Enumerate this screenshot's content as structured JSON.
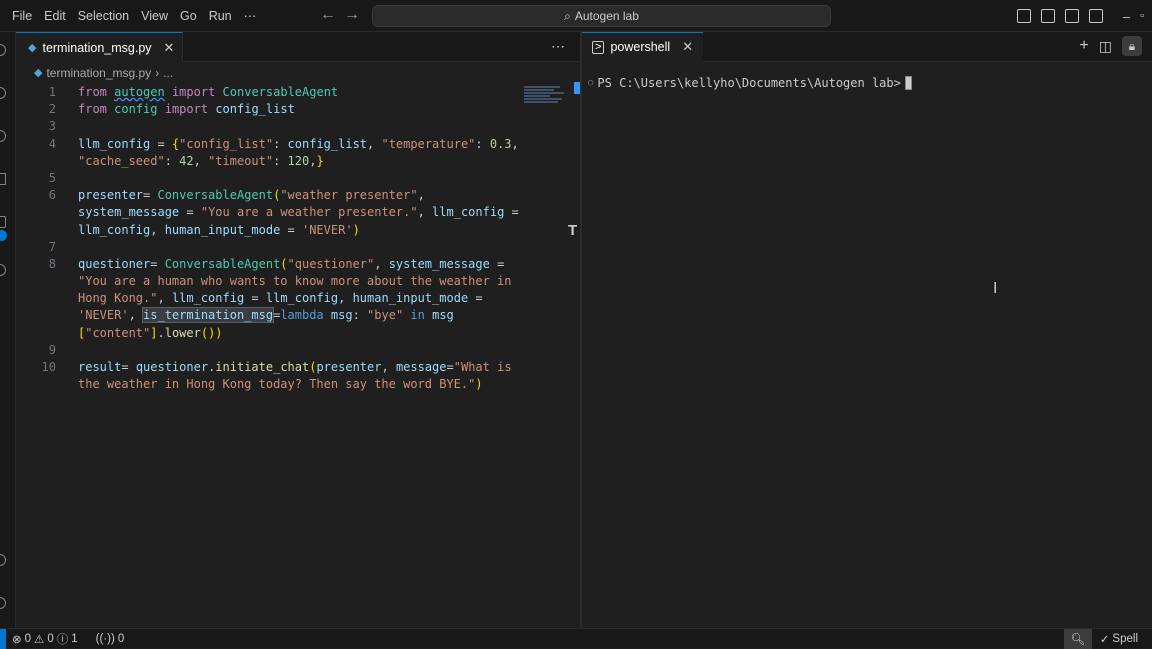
{
  "menu": [
    "File",
    "Edit",
    "Selection",
    "View",
    "Go",
    "Run",
    "⋯"
  ],
  "search_text": "Autogen lab",
  "editor": {
    "tab_label": "termination_msg.py",
    "breadcrumb": [
      "termination_msg.py",
      "..."
    ]
  },
  "code": {
    "ln1": "1",
    "ln2": "2",
    "ln3": "3",
    "ln4": "4",
    "ln5": "5",
    "ln6": "6",
    "ln7": "7",
    "ln8": "8",
    "ln9": "9",
    "ln10": "10"
  },
  "terminal": {
    "tab_label": "powershell",
    "prompt": "PS C:\\Users\\kellyho\\Documents\\Autogen lab>"
  },
  "status": {
    "errors": "0",
    "warnings": "0",
    "info": "1",
    "ports": "0",
    "spell": "Spell"
  }
}
